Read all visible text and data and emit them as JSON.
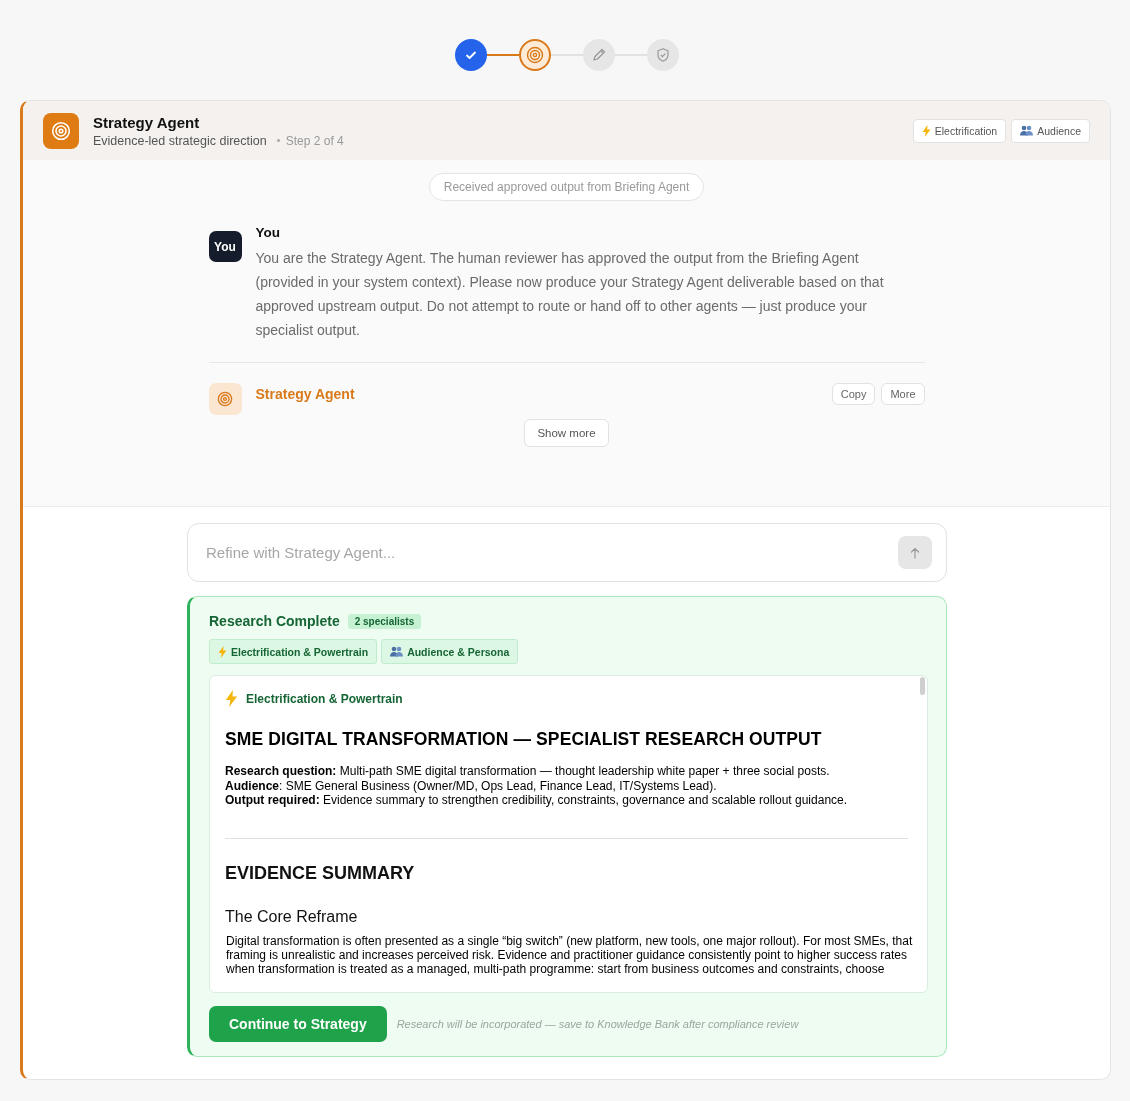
{
  "stepper": [
    {
      "kind": "check",
      "done": true,
      "active": false
    },
    {
      "kind": "target",
      "done": false,
      "active": true
    },
    {
      "kind": "pencil",
      "done": false,
      "active": false
    },
    {
      "kind": "shield",
      "done": false,
      "active": false
    }
  ],
  "agent": {
    "title": "Strategy Agent",
    "subtitle": "Evidence-led strategic direction",
    "step": "Step 2 of 4",
    "tags": [
      {
        "kind": "bolt",
        "label": "Electrification"
      },
      {
        "kind": "people",
        "label": "Audience"
      }
    ]
  },
  "notice": "Received approved output from Briefing Agent",
  "messages": [
    {
      "kind": "user",
      "avatar": "You",
      "author": "You",
      "text": "You are the Strategy Agent. The human reviewer has approved the output from the Briefing Agent (provided in your system context). Please now produce your Strategy Agent deliverable based on that approved upstream output. Do not attempt to route or hand off to other agents — just produce your specialist output."
    },
    {
      "kind": "agent",
      "author": "Strategy Agent",
      "actions": [
        "Copy",
        "More"
      ]
    }
  ],
  "show_more": "Show more",
  "input": {
    "placeholder": "Refine with Strategy Agent...",
    "send_enabled": false
  },
  "research": {
    "title": "Research Complete",
    "badge": "2 specialists",
    "tabs": [
      {
        "kind": "bolt",
        "label": "Electrification & Powertrain"
      },
      {
        "kind": "people",
        "label": "Audience & Persona"
      }
    ],
    "document": {
      "source": {
        "kind": "bolt",
        "label": "Electrification & Powertrain"
      },
      "heading": "SME DIGITAL TRANSFORMATION — SPECIALIST RESEARCH OUTPUT",
      "fields": [
        "**Research question:** Multi-path SME digital transformation — thought leadership white paper + three social posts.",
        "**Audience**: SME General Business (Owner/MD, Ops Lead, Finance Lead, IT/Systems Lead).",
        "**Output required:** Evidence summary to strengthen credibility, constraints, governance and scalable rollout guidance."
      ],
      "section": "EVIDENCE SUMMARY",
      "subheading": "The Core Reframe",
      "paragraph": "Digital transformation is often presented as a single “big switch” (new platform, new tools, one major rollout). For most SMEs, that framing is unrealistic and increases perceived risk. Evidence and practitioner guidance consistently point to higher success rates when transformation is treated as a managed, multi-path programme: start from business outcomes and constraints, choose"
    },
    "button": "Continue to Strategy",
    "note": "Research will be incorporated — save to Knowledge Bank after compliance review"
  }
}
